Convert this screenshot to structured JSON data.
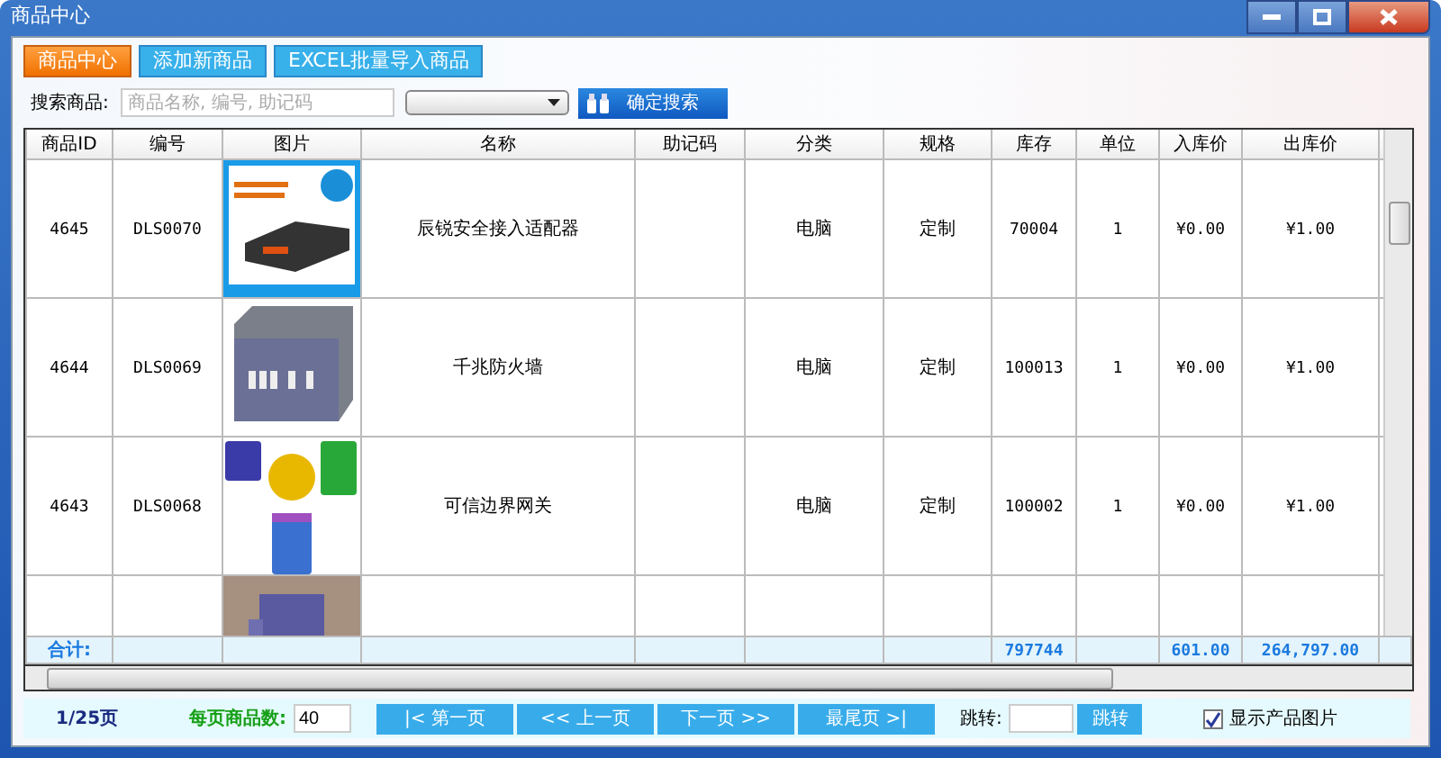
{
  "window": {
    "title": "商品中心"
  },
  "tabs": [
    {
      "label": "商品中心",
      "selected": true
    },
    {
      "label": "添加新商品",
      "selected": false
    },
    {
      "label": "EXCEL批量导入商品",
      "selected": false
    }
  ],
  "search": {
    "label": "搜索商品:",
    "placeholder": "商品名称, 编号, 助记码",
    "button": "确定搜索"
  },
  "table": {
    "columns": [
      "商品ID",
      "编号",
      "图片",
      "名称",
      "助记码",
      "分类",
      "规格",
      "库存",
      "单位",
      "入库价",
      "出库价"
    ],
    "rows": [
      {
        "cells": [
          "4645",
          "DLS0070",
          {
            "kind": "picture"
          },
          "辰锐安全接入适配器",
          null,
          "电脑",
          "定制",
          "70004",
          "1",
          "¥0.00",
          "¥1.00"
        ]
      },
      {
        "cells": [
          "4644",
          "DLS0069",
          {
            "kind": "picture"
          },
          "千兆防火墙",
          null,
          "电脑",
          "定制",
          "100013",
          "1",
          "¥0.00",
          "¥1.00"
        ]
      },
      {
        "cells": [
          "4643",
          "DLS0068",
          {
            "kind": "picture"
          },
          "可信边界网关",
          null,
          "电脑",
          "定制",
          "100002",
          "1",
          "¥0.00",
          "¥1.00"
        ]
      },
      {
        "cells": [
          null,
          null,
          {
            "kind": "picture"
          },
          null,
          null,
          null,
          null,
          null,
          null,
          null,
          null
        ]
      }
    ],
    "totals": {
      "label": "合计:",
      "stock": "797744",
      "purchase_price": "601.00",
      "sale_price": "264,797.00"
    }
  },
  "footer": {
    "page": "1/25页",
    "per_page_label": "每页商品数:",
    "per_page": "40",
    "buttons": [
      "|< 第一页",
      "<< 上一页",
      "下一页 >>",
      "最尾页 >|"
    ],
    "jump_label": "跳转:",
    "jump_button": "跳转",
    "show_pictures": {
      "label": "显示产品图片",
      "checked": true
    }
  }
}
